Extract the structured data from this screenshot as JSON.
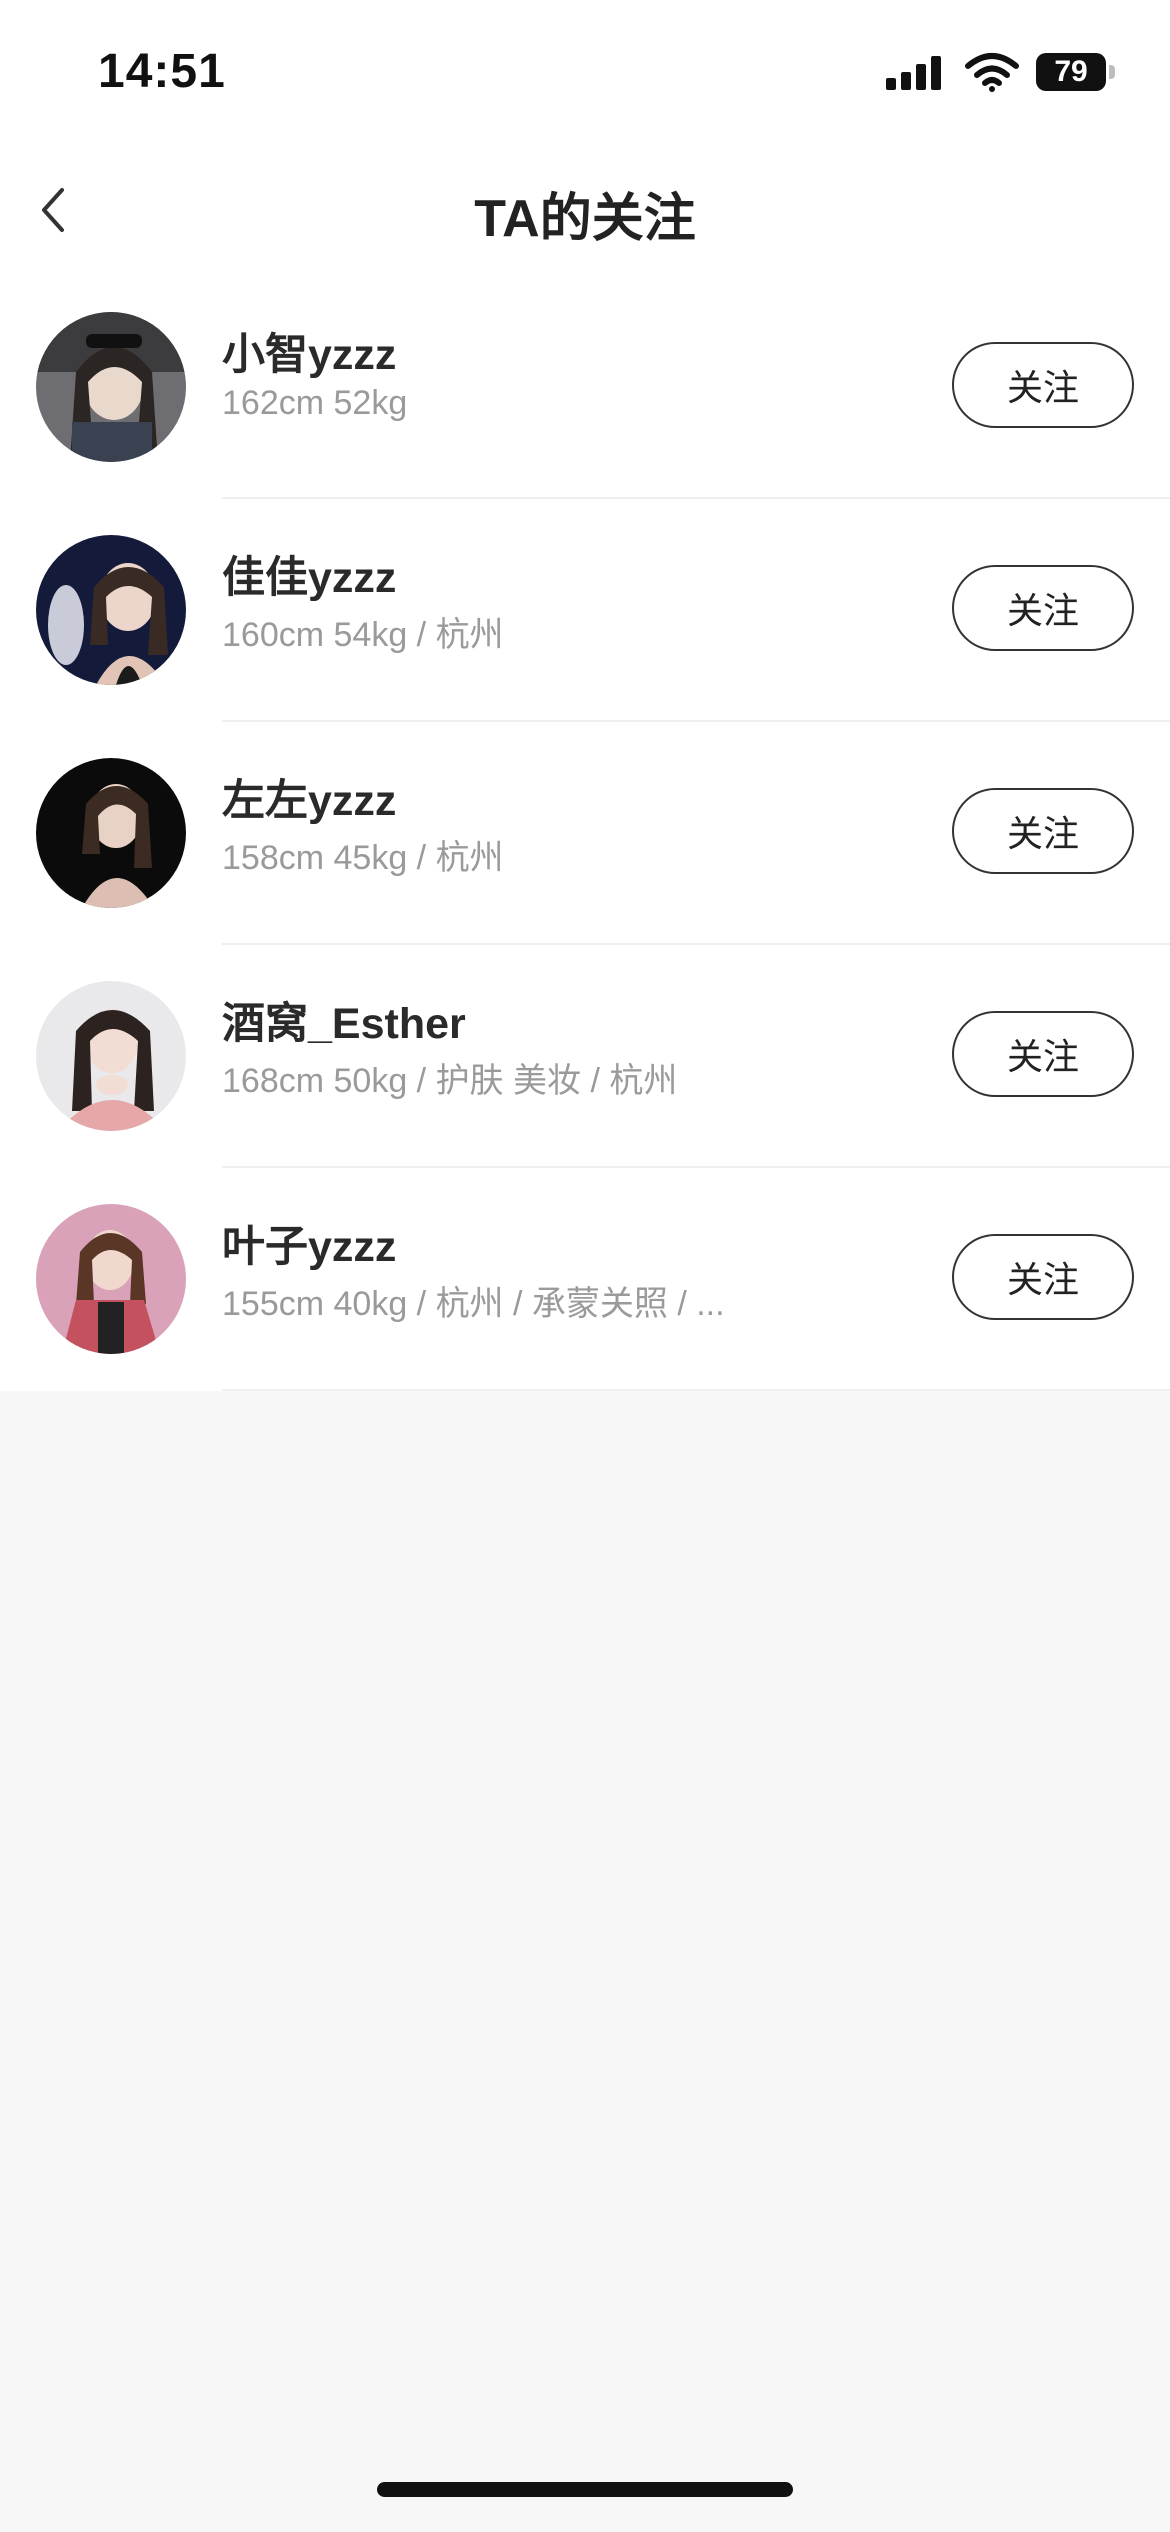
{
  "status_bar": {
    "time": "14:51",
    "battery": "79",
    "icons": [
      "signal-icon",
      "wifi-icon",
      "battery-icon"
    ]
  },
  "nav": {
    "title": "TA的关注",
    "back_icon": "chevron-left-icon"
  },
  "users": [
    {
      "name": "小智yzzz",
      "meta": "162cm 52kg",
      "button": "关注"
    },
    {
      "name": "佳佳yzzz",
      "meta": "160cm 54kg / 杭州",
      "button": "关注"
    },
    {
      "name": "左左yzzz",
      "meta": "158cm 45kg / 杭州",
      "button": "关注"
    },
    {
      "name": "酒窝_Esther",
      "meta": "168cm 50kg / 护肤 美妆 / 杭州",
      "button": "关注"
    },
    {
      "name": "叶子yzzz",
      "meta": "155cm 40kg / 杭州 / 承蒙关照 / ...",
      "button": "关注"
    }
  ],
  "colors": {
    "background": "#f7f7f7",
    "card": "#ffffff",
    "text_primary": "#2a2a2a",
    "text_secondary": "#9a9a9a"
  }
}
